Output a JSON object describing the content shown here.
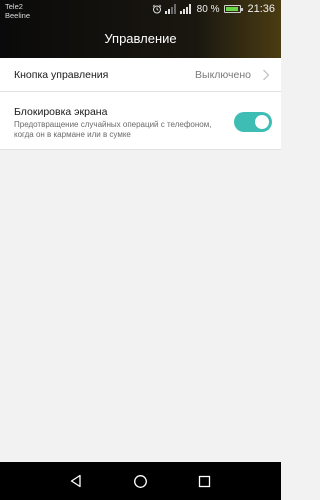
{
  "status_bar": {
    "carrier_1": "Tele2",
    "carrier_2": "Beeline",
    "battery_percent": "80 %",
    "time": "21:36",
    "icons": [
      "alarm-icon",
      "signal-1-icon",
      "signal-2-icon",
      "battery-icon"
    ]
  },
  "header": {
    "title": "Управление"
  },
  "settings": {
    "control_button": {
      "label": "Кнопка управления",
      "value": "Выключено"
    },
    "screen_lock": {
      "label": "Блокировка экрана",
      "description": "Предотвращение случайных операций с телефоном, когда он в кармане или в сумке",
      "enabled": true
    }
  },
  "nav_bar": {
    "buttons": [
      "back-icon",
      "home-icon",
      "recents-icon"
    ]
  },
  "colors": {
    "accent": "#3dbdb4",
    "header_bg": "#0a0a0a",
    "background": "#f2f2f2"
  }
}
